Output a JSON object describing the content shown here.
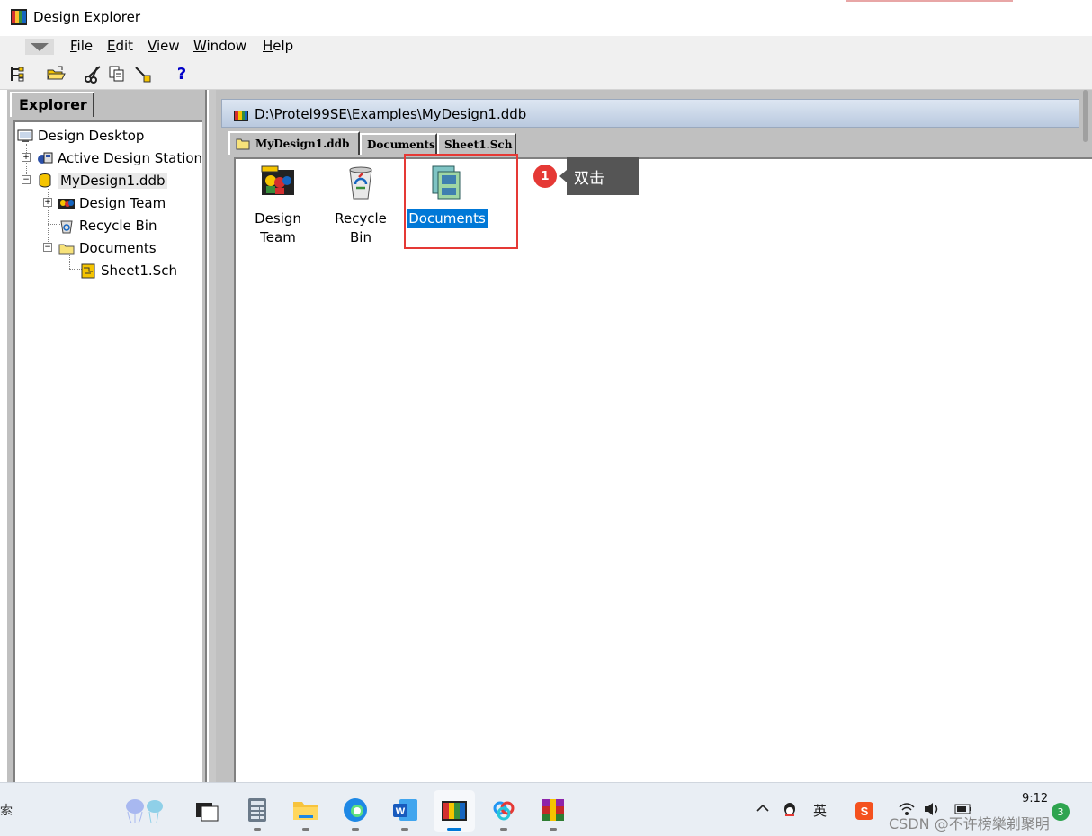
{
  "window": {
    "title": "Design Explorer"
  },
  "menu": {
    "items": [
      {
        "label": "File",
        "mnemonic": "F",
        "rest": "ile"
      },
      {
        "label": "Edit",
        "mnemonic": "E",
        "rest": "dit"
      },
      {
        "label": "View",
        "mnemonic": "V",
        "rest": "iew"
      },
      {
        "label": "Window",
        "mnemonic": "W",
        "rest": "indow"
      },
      {
        "label": "Help",
        "mnemonic": "H",
        "rest": "elp"
      }
    ]
  },
  "toolbar": {
    "icons": [
      "explorer-tree-icon",
      "open-folder-icon",
      "cut-icon",
      "copy-icon",
      "paste-icon",
      "help-icon"
    ],
    "help_label": "?"
  },
  "explorer": {
    "tab_label": "Explorer",
    "tree": [
      {
        "label": "Design Desktop"
      },
      {
        "label": "Active Design Stations"
      },
      {
        "label": "MyDesign1.ddb"
      },
      {
        "label": "Design Team"
      },
      {
        "label": "Recycle Bin"
      },
      {
        "label": "Documents"
      },
      {
        "label": "Sheet1.Sch"
      }
    ]
  },
  "document": {
    "path": "D:\\Protel99SE\\Examples\\MyDesign1.ddb",
    "tabs": [
      {
        "label": "MyDesign1.ddb",
        "active": true
      },
      {
        "label": "Documents",
        "active": false
      },
      {
        "label": "Sheet1.Sch",
        "active": false
      }
    ],
    "items": [
      {
        "line1": "Design",
        "line2": "Team",
        "selected": false
      },
      {
        "line1": "Recycle Bin",
        "line2": "",
        "selected": false
      },
      {
        "line1": "Documents",
        "line2": "",
        "selected": true
      }
    ]
  },
  "annotation": {
    "step": "1",
    "text": "双击",
    "color": "#e53935"
  },
  "taskbar": {
    "search_fragment": "索",
    "tray": {
      "ime": "英",
      "time": "9:12",
      "notifications": "3"
    },
    "watermark": "CSDN @不许榜樂剃聚明"
  },
  "colors": {
    "selection": "#0078d7",
    "panel": "#c0c0c0"
  }
}
